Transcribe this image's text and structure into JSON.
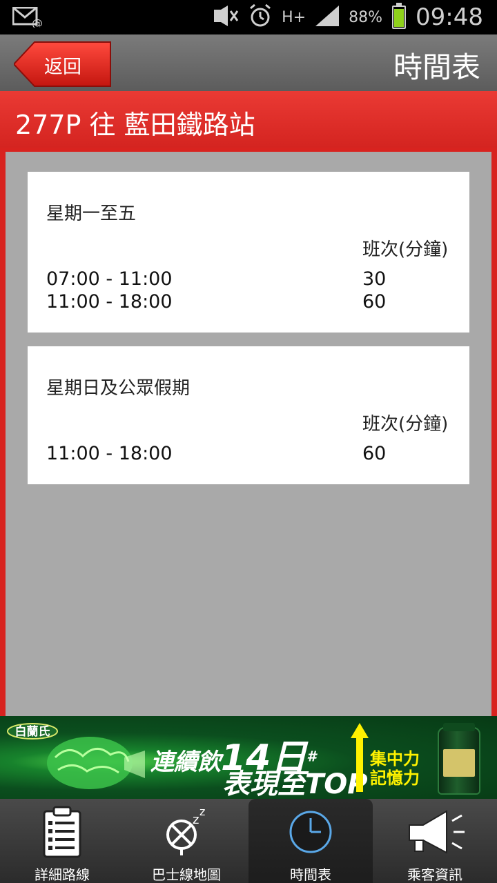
{
  "status_bar": {
    "battery": "88%",
    "network": "H+",
    "time": "09:48",
    "battery_level": 0.88
  },
  "header": {
    "back_label": "返回",
    "title": "時間表"
  },
  "route": {
    "title": "277P 往 藍田鐵路站"
  },
  "schedules": [
    {
      "day": "星期一至五",
      "column_header": "班次(分鐘)",
      "rows": [
        {
          "period": "07:00 - 11:00",
          "frequency": "30"
        },
        {
          "period": "11:00 - 18:00",
          "frequency": "60"
        }
      ]
    },
    {
      "day": "星期日及公眾假期",
      "column_header": "班次(分鐘)",
      "rows": [
        {
          "period": "11:00 - 18:00",
          "frequency": "60"
        }
      ]
    }
  ],
  "ad": {
    "brand": "白蘭氏",
    "line1_a": "連續飲",
    "line1_b": "14日",
    "line1_mark": "#",
    "line2": "表現至TOP",
    "side1": "集中力",
    "side2": "記憶力"
  },
  "nav": {
    "items": [
      {
        "label": "詳細路線",
        "icon": "clipboard-icon"
      },
      {
        "label": "巴士線地圖",
        "icon": "bus-map-icon"
      },
      {
        "label": "時間表",
        "icon": "clock-icon"
      },
      {
        "label": "乘客資訊",
        "icon": "megaphone-icon"
      }
    ]
  },
  "colors": {
    "header_gray": "#6b6b6b",
    "route_red": "#e03030",
    "content_gray": "#a9a9a9",
    "ad_green": "#0b4e1e",
    "battery_green": "#8fd11c"
  }
}
